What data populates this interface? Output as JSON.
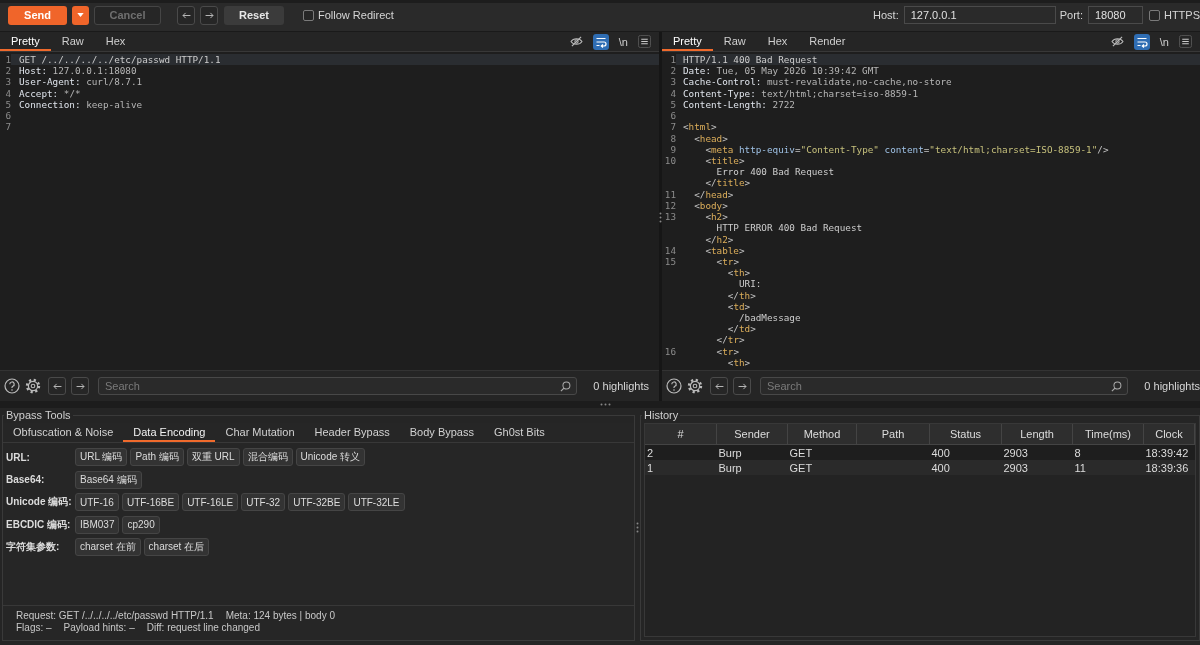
{
  "toolbar": {
    "send": {
      "label": "Send"
    },
    "cancel": {
      "label": "Cancel",
      "disabled": true
    },
    "reset": {
      "label": "Reset"
    },
    "follow_redirect": {
      "label": "Follow Redirect",
      "checked": false
    },
    "host": {
      "label": "Host:",
      "value": "127.0.0.1"
    },
    "port": {
      "label": "Port:",
      "value": "18080"
    },
    "https": {
      "label": "HTTPS",
      "checked": false
    }
  },
  "request_pane": {
    "tabs": [
      {
        "label": "Pretty",
        "selected": true
      },
      {
        "label": "Raw",
        "selected": false
      },
      {
        "label": "Hex",
        "selected": false
      }
    ],
    "wrap_on": true,
    "newline_button": "\\n",
    "lines": [
      {
        "number": "1",
        "current": true,
        "rows": [
          "GET /../../../../etc/passwd HTTP/1.1"
        ]
      },
      {
        "number": "2",
        "current": false,
        "rows": [
          "Host: 127.0.0.1:18080"
        ]
      },
      {
        "number": "3",
        "current": false,
        "rows": [
          "User-Agent: curl/8.7.1"
        ]
      },
      {
        "number": "4",
        "current": false,
        "rows": [
          "Accept: */*"
        ]
      },
      {
        "number": "5",
        "current": false,
        "rows": [
          "Connection: keep-alive"
        ]
      },
      {
        "number": "6",
        "current": false
      },
      {
        "number": "7",
        "current": false
      }
    ],
    "search": {
      "placeholder": "Search"
    },
    "highlights": "0 highlights"
  },
  "response_pane": {
    "tabs": [
      {
        "label": "Pretty",
        "selected": true
      },
      {
        "label": "Raw",
        "selected": false
      },
      {
        "label": "Hex",
        "selected": false
      },
      {
        "label": "Render",
        "selected": false
      }
    ],
    "wrap_on": true,
    "newline_button": "\\n",
    "lines": [
      {
        "number": "1",
        "current": true,
        "rows": [
          "HTTP/1.1 400 Bad Request"
        ]
      },
      {
        "number": "2",
        "current": false,
        "rows": [
          "Date: Tue, 05 May 2026 10:39:42 GMT"
        ]
      },
      {
        "number": "3",
        "current": false,
        "rows": [
          "Cache-Control: must-revalidate,no-cache,no-store"
        ]
      },
      {
        "number": "4",
        "current": false,
        "rows": [
          "Content-Type: text/html;charset=iso-8859-1"
        ]
      },
      {
        "number": "5",
        "current": false,
        "rows": [
          "Content-Length: 2722"
        ]
      },
      {
        "number": "6",
        "current": false
      },
      {
        "number": "7",
        "current": false,
        "rows": [
          "<html>"
        ]
      },
      {
        "number": "8",
        "current": false,
        "rows": [
          "  <head>"
        ]
      },
      {
        "number": "9",
        "current": false,
        "rows": [
          "    <meta http-equiv=\"Content-Type\" content=\"text/html;charset=ISO-8859-1\"/>"
        ]
      },
      {
        "number": "10",
        "current": false,
        "rows": [
          "    <title>",
          "      Error 400 Bad Request",
          "    </title>"
        ]
      },
      {
        "number": "11",
        "current": false,
        "rows": [
          "  </head>"
        ]
      },
      {
        "number": "12",
        "current": false,
        "rows": [
          "  <body>"
        ]
      },
      {
        "number": "13",
        "current": false,
        "rows": [
          "    <h2>",
          "      HTTP ERROR 400 Bad Request",
          "    </h2>"
        ]
      },
      {
        "number": "14",
        "current": false,
        "rows": [
          "    <table>"
        ]
      },
      {
        "number": "15",
        "current": false,
        "rows": [
          "      <tr>",
          "        <th>",
          "          URI:",
          "        </th>",
          "        <td>",
          "          /badMessage",
          "        </td>",
          "      </tr>"
        ]
      },
      {
        "number": "16",
        "current": false,
        "rows": [
          "      <tr>",
          "        <th>"
        ]
      }
    ],
    "search": {
      "placeholder": "Search"
    },
    "highlights": "0 highlights"
  },
  "bypass_tools": {
    "title": "Bypass Tools",
    "tabs": [
      {
        "label": "Obfuscation & Noise",
        "selected": false
      },
      {
        "label": "Data Encoding",
        "selected": true
      },
      {
        "label": "Char Mutation",
        "selected": false
      },
      {
        "label": "Header Bypass",
        "selected": false
      },
      {
        "label": "Body Bypass",
        "selected": false
      },
      {
        "label": "Gh0st Bits",
        "selected": false
      }
    ],
    "rows": [
      {
        "label": "URL:",
        "buttons": [
          "URL 编码",
          "Path 编码",
          "双重 URL",
          "混合编码",
          "Unicode 转义"
        ]
      },
      {
        "label": "Base64:",
        "buttons": [
          "Base64 编码"
        ]
      },
      {
        "label": "Unicode 编码:",
        "buttons": [
          "UTF-16",
          "UTF-16BE",
          "UTF-16LE",
          "UTF-32",
          "UTF-32BE",
          "UTF-32LE"
        ]
      },
      {
        "label": "EBCDIC 编码:",
        "buttons": [
          "IBM037",
          "cp290"
        ]
      },
      {
        "label": "字符集参数:",
        "buttons": [
          "charset 在前",
          "charset 在后"
        ]
      }
    ],
    "status": [
      [
        "Request: GET /../../../../etc/passwd HTTP/1.1",
        "Meta: 124 bytes | body 0"
      ],
      [
        "Flags: –",
        "Payload hints: –",
        "Diff: request line changed"
      ]
    ]
  },
  "history": {
    "title": "History",
    "columns": [
      "#",
      "Sender",
      "Method",
      "Path",
      "Status",
      "Length",
      "Time(ms)",
      "Clock"
    ],
    "rows": [
      [
        "2",
        "Burp",
        "GET",
        null,
        "400",
        "2903",
        "8",
        "18:39:42"
      ],
      [
        "1",
        "Burp",
        "GET",
        null,
        "400",
        "2903",
        "11",
        "18:39:36"
      ]
    ]
  }
}
